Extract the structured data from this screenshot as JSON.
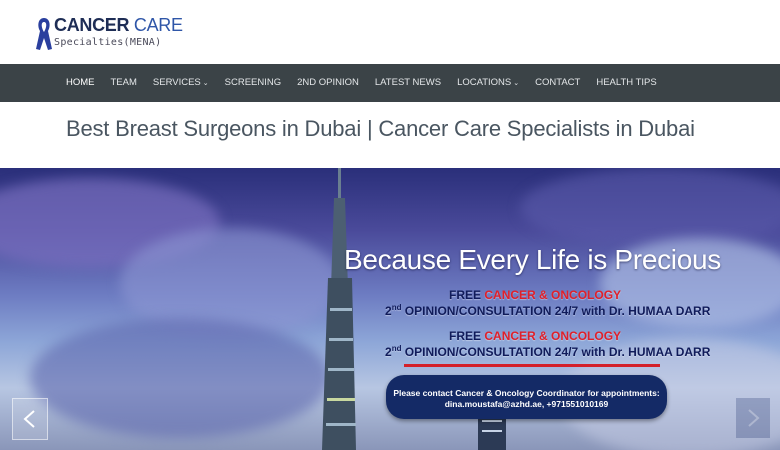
{
  "logo": {
    "word1": "CANCER",
    "word2": "CARE",
    "tagline": "Specialties(MENA)"
  },
  "nav": {
    "items": [
      {
        "label": "HOME",
        "dropdown": false
      },
      {
        "label": "TEAM",
        "dropdown": false
      },
      {
        "label": "SERVICES",
        "dropdown": true
      },
      {
        "label": "SCREENING",
        "dropdown": false
      },
      {
        "label": "2ND OPINION",
        "dropdown": false
      },
      {
        "label": "LATEST NEWS",
        "dropdown": false
      },
      {
        "label": "LOCATIONS",
        "dropdown": true
      },
      {
        "label": "CONTACT",
        "dropdown": false
      },
      {
        "label": "HEALTH TIPS",
        "dropdown": false
      }
    ],
    "caret": "⌄"
  },
  "page_title": "Best Breast Surgeons in Dubai | Cancer Care Specialists in Dubai",
  "hero": {
    "headline": "Because Every Life is Precious",
    "promo": {
      "free": "FREE",
      "highlight": "CANCER & ONCOLOGY",
      "ordinal_num": "2",
      "ordinal_suffix": "nd",
      "line2_text": " OPINION/CONSULTATION 24/7 with Dr. HUMAA DARR"
    },
    "contact": {
      "line1": "Please contact Cancer & Oncology Coordinator for appointments:",
      "line2": "dina.moustafa@azhd.ae,  +971551010169"
    }
  },
  "colors": {
    "nav_bg": "#3b4347",
    "title_text": "#4a5661",
    "accent_red": "#e0202a",
    "contact_bg": "#142a66",
    "logo_blue": "#2f56a8"
  }
}
